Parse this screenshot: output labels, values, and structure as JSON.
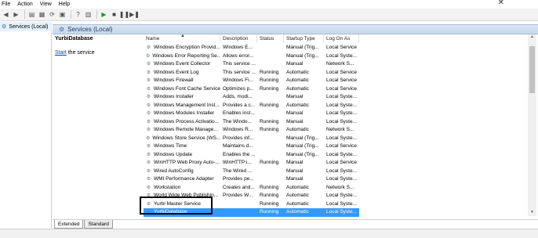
{
  "menu": {
    "file": "File",
    "action": "Action",
    "view": "View",
    "help": "Help"
  },
  "tree": {
    "services_local": "Services (Local)"
  },
  "header": {
    "title": "Services (Local)"
  },
  "desc_pane": {
    "title": "YurbiDatabase",
    "start_link": "Start",
    "start_suffix": " the service"
  },
  "columns": {
    "name": "Name",
    "description": "Description",
    "status": "Status",
    "startup": "Startup Type",
    "logon": "Log On As"
  },
  "rows": [
    {
      "name": "Windows Encryption Provid...",
      "desc": "Windows E...",
      "status": "",
      "startup": "Manual (Trig...",
      "logon": "Local Service"
    },
    {
      "name": "Windows Error Reporting Se...",
      "desc": "Allows error...",
      "status": "",
      "startup": "Manual (Trig...",
      "logon": "Local Syste..."
    },
    {
      "name": "Windows Event Collector",
      "desc": "This service ...",
      "status": "",
      "startup": "Manual",
      "logon": "Network S..."
    },
    {
      "name": "Windows Event Log",
      "desc": "This service ...",
      "status": "Running",
      "startup": "Automatic",
      "logon": "Local Service"
    },
    {
      "name": "Windows Firewall",
      "desc": "Windows Fi...",
      "status": "Running",
      "startup": "Automatic",
      "logon": "Local Service"
    },
    {
      "name": "Windows Font Cache Service",
      "desc": "Optimizes p...",
      "status": "Running",
      "startup": "Automatic",
      "logon": "Local Service"
    },
    {
      "name": "Windows Installer",
      "desc": "Adds, modi...",
      "status": "",
      "startup": "Manual",
      "logon": "Local Syste..."
    },
    {
      "name": "Windows Management Inst...",
      "desc": "Provides a c...",
      "status": "Running",
      "startup": "Automatic",
      "logon": "Local Syste..."
    },
    {
      "name": "Windows Modules Installer",
      "desc": "Enables inst...",
      "status": "",
      "startup": "Manual",
      "logon": "Local Syste..."
    },
    {
      "name": "Windows Process Activatio...",
      "desc": "The Windo...",
      "status": "Running",
      "startup": "Manual",
      "logon": "Local Syste..."
    },
    {
      "name": "Windows Remote Manage...",
      "desc": "Windows R...",
      "status": "Running",
      "startup": "Automatic",
      "logon": "Network S..."
    },
    {
      "name": "Windows Store Service (WS...",
      "desc": "Provides inf...",
      "status": "",
      "startup": "Manual (Trig...",
      "logon": "Local Syste..."
    },
    {
      "name": "Windows Time",
      "desc": "Maintains d...",
      "status": "",
      "startup": "Manual (Trig...",
      "logon": "Local Service"
    },
    {
      "name": "Windows Update",
      "desc": "Enables the ...",
      "status": "",
      "startup": "Manual (Trig...",
      "logon": "Local Syste..."
    },
    {
      "name": "WinHTTP Web Proxy Auto-...",
      "desc": "WinHTTP i...",
      "status": "Running",
      "startup": "Manual",
      "logon": "Local Service"
    },
    {
      "name": "Wired AutoConfig",
      "desc": "The Wired ...",
      "status": "",
      "startup": "Manual",
      "logon": "Local Syste..."
    },
    {
      "name": "WMI Performance Adapter",
      "desc": "Provides pe...",
      "status": "",
      "startup": "Manual",
      "logon": "Local Syste..."
    },
    {
      "name": "Workstation",
      "desc": "Creates and...",
      "status": "Running",
      "startup": "Automatic",
      "logon": "Network S..."
    },
    {
      "name": "World Wide Web Publishin...",
      "desc": "Provides W...",
      "status": "Running",
      "startup": "Automatic",
      "logon": "Local Syste..."
    },
    {
      "name": "Yurbi Master Service",
      "desc": "",
      "status": "Running",
      "startup": "Automatic",
      "logon": "Local Syste..."
    },
    {
      "name": "YurbiDatabase",
      "desc": "",
      "status": "Running",
      "startup": "Automatic",
      "logon": "Local Syste...",
      "selected": true
    }
  ],
  "tabs": {
    "extended": "Extended",
    "standard": "Standard"
  }
}
